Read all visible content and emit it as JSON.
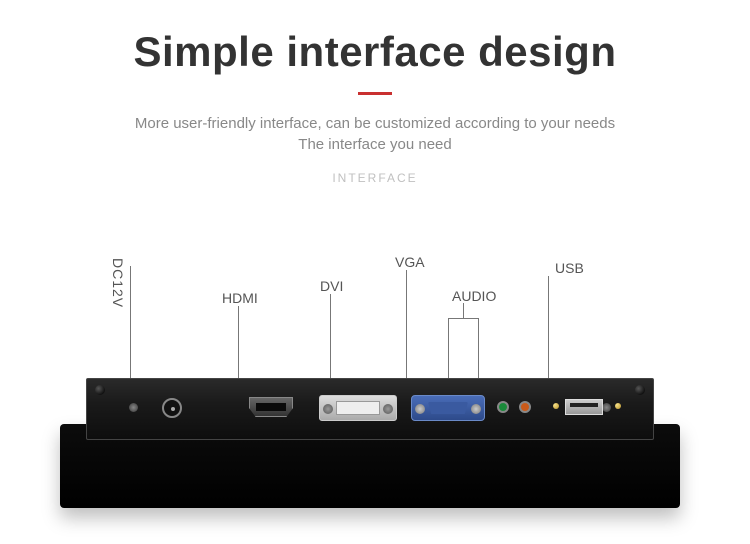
{
  "title": "Simple interface design",
  "subtitle1": "More user-friendly interface, can be customized according to your needs",
  "subtitle2": "The interface you need",
  "section_tag": "INTERFACE",
  "ports": {
    "dc": "DC12V",
    "hdmi": "HDMI",
    "dvi": "DVI",
    "vga": "VGA",
    "audio": "AUDIO",
    "usb": "USB"
  }
}
